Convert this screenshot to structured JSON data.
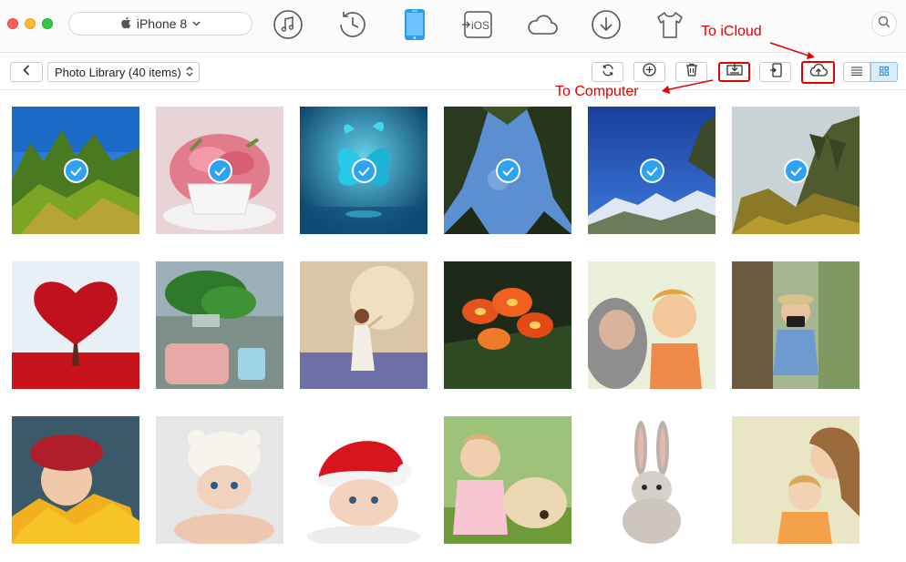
{
  "window": {
    "device": "iPhone 8"
  },
  "nav": [
    {
      "name": "music-icon"
    },
    {
      "name": "history-icon"
    },
    {
      "name": "iphone-icon",
      "active": true
    },
    {
      "name": "to-ios-icon",
      "label": "iOS"
    },
    {
      "name": "icloud-icon"
    },
    {
      "name": "download-icon"
    },
    {
      "name": "shirt-icon"
    }
  ],
  "toolbar": {
    "library": "Photo Library (40 items)",
    "buttons": [
      "refresh-icon",
      "add-icon",
      "delete-icon",
      "to-computer-icon",
      "to-device-icon",
      "to-icloud-icon"
    ],
    "view_modes": [
      "list-view-icon",
      "grid-view-icon"
    ],
    "active_view": "grid"
  },
  "annotations": {
    "to_icloud": "To iCloud",
    "to_computer": "To Computer"
  },
  "colors": {
    "annotation": "#e00000",
    "accent": "#2ea3f2",
    "active_view_bg": "#d9ecfb"
  },
  "photos": [
    {
      "subject": "trees-blue-sky",
      "selected": true
    },
    {
      "subject": "pink-flower-cupcake",
      "selected": true
    },
    {
      "subject": "blue-butterflies",
      "selected": true
    },
    {
      "subject": "forest-canopy",
      "selected": true
    },
    {
      "subject": "snowy-mountains",
      "selected": true
    },
    {
      "subject": "autumn-trees",
      "selected": true
    },
    {
      "subject": "red-heart-tree",
      "selected": false
    },
    {
      "subject": "office-plant",
      "selected": false
    },
    {
      "subject": "girl-in-field",
      "selected": false
    },
    {
      "subject": "orange-flowers",
      "selected": false
    },
    {
      "subject": "child-with-grandmother",
      "selected": false
    },
    {
      "subject": "child-with-camera",
      "selected": false
    },
    {
      "subject": "girl-red-hat-leaves",
      "selected": false
    },
    {
      "subject": "baby-bear-hat",
      "selected": false
    },
    {
      "subject": "baby-santa-hat",
      "selected": false
    },
    {
      "subject": "toddler-with-dog",
      "selected": false
    },
    {
      "subject": "white-rabbit",
      "selected": false
    },
    {
      "subject": "mother-and-daughter",
      "selected": false
    }
  ]
}
